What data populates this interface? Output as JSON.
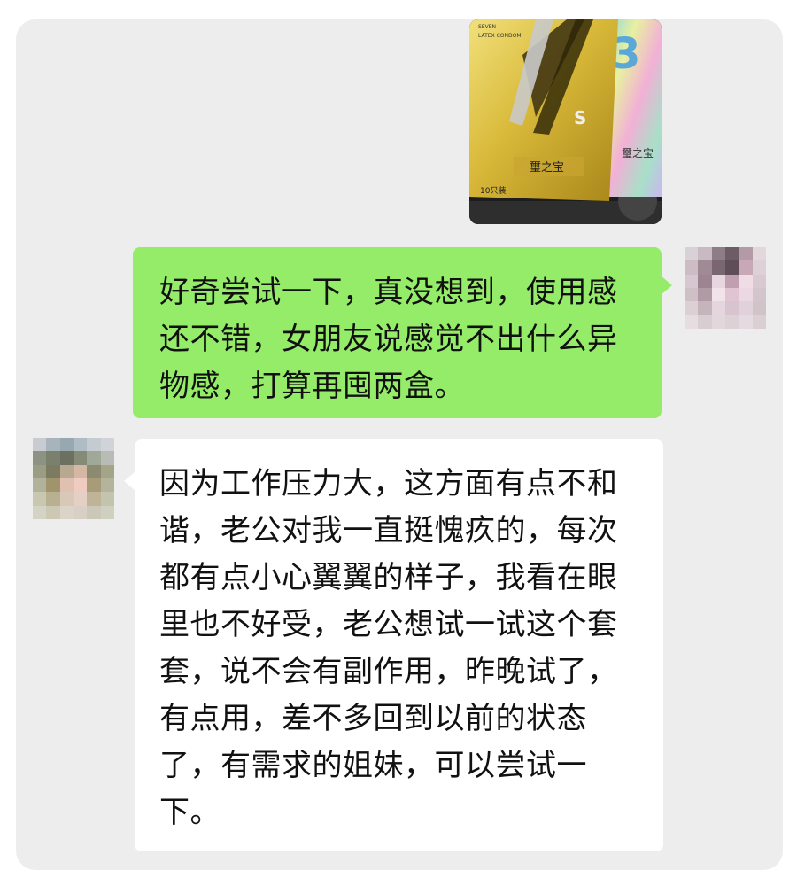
{
  "messages": [
    {
      "type": "image",
      "sender": "self",
      "image": {
        "lines": [
          "SEVEN",
          "LATEX CONDOM"
        ],
        "big_number": "3",
        "letter": "S",
        "brand_main": "璽之宝",
        "brand_side": "璽之宝",
        "count": "10只装"
      }
    },
    {
      "type": "text",
      "sender": "self",
      "lines": [
        "好奇尝试一下，真没想到，使用感",
        "还不错，女朋友说感觉不出什么异",
        "物感，打算再囤两盒。"
      ]
    },
    {
      "type": "text",
      "sender": "other",
      "lines": [
        "因为工作压力大，这方面有点不和",
        "谐，老公对我一直挺愧疚的，每次",
        "都有点小心翼翼的样子，我看在眼",
        "里也不好受，老公想试一试这个套",
        "套，说不会有副作用，昨晚试了，",
        "有点用，差不多回到以前的状态",
        "了，有需求的姐妹，可以尝试一",
        "下。"
      ]
    }
  ],
  "colors": {
    "chat_background": "#ededed",
    "sent_bubble": "#95ec69",
    "received_bubble": "#ffffff"
  }
}
